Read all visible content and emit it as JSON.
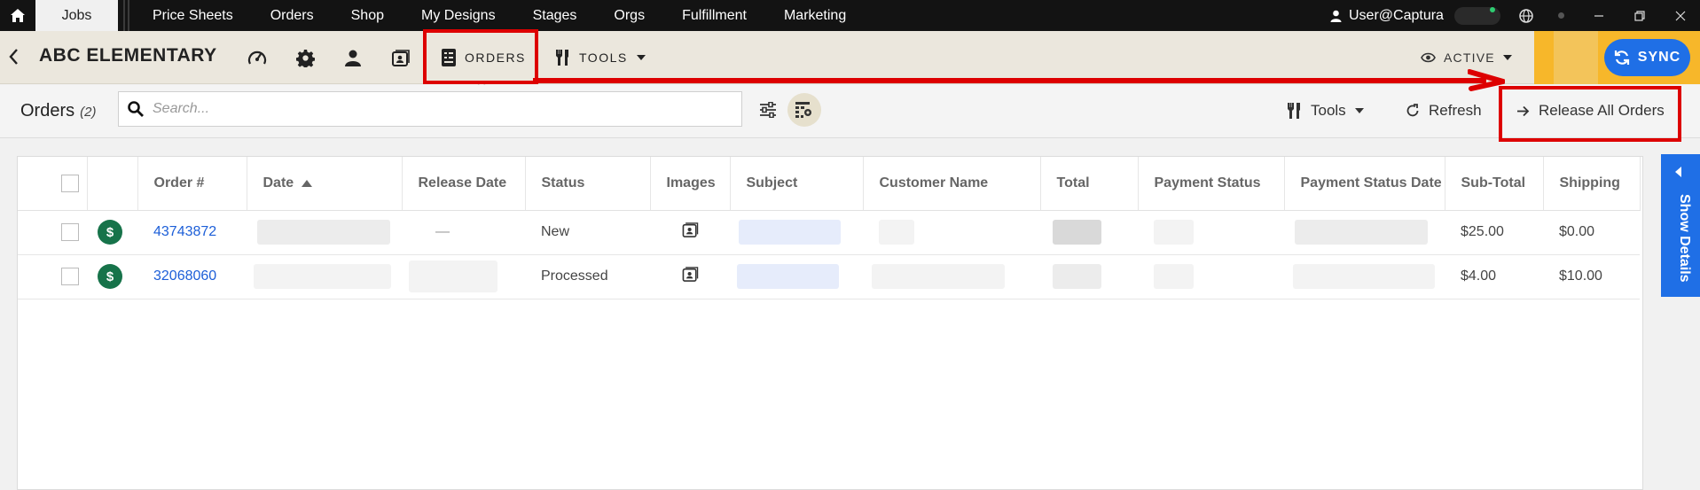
{
  "topnav": {
    "tabs": [
      {
        "label": "Jobs"
      },
      {
        "label": "Price Sheets"
      },
      {
        "label": "Orders"
      },
      {
        "label": "Shop"
      },
      {
        "label": "My Designs"
      },
      {
        "label": "Stages"
      },
      {
        "label": "Orgs"
      },
      {
        "label": "Fulfillment"
      },
      {
        "label": "Marketing"
      }
    ],
    "active_tab": "Jobs",
    "user": "User@Captura",
    "status_dot_color": "#2ecc71"
  },
  "jobbar": {
    "title": "ABC ELEMENTARY",
    "icons": [
      "dashboard-icon",
      "gear-icon",
      "person-icon",
      "contact-card-icon"
    ],
    "orders_tab": "ORDERS",
    "tools_tab": "TOOLS",
    "status": "ACTIVE",
    "sync_label": "SYNC"
  },
  "ordersbar": {
    "title": "Orders",
    "count": "(2)",
    "search_placeholder": "Search...",
    "tools_label": "Tools",
    "refresh_label": "Refresh",
    "release_label": "Release All Orders"
  },
  "table": {
    "columns": [
      "Order #",
      "Date",
      "Release Date",
      "Status",
      "Images",
      "Subject",
      "Customer Name",
      "Total",
      "Payment Status",
      "Payment Status Date",
      "Sub-Total",
      "Shipping"
    ],
    "sort_column": "Date",
    "rows": [
      {
        "order": "43743872",
        "release": "—",
        "status": "New",
        "subtotal": "$25.00",
        "shipping": "$0.00"
      },
      {
        "order": "32068060",
        "release": "",
        "status": "Processed",
        "subtotal": "$4.00",
        "shipping": "$10.00"
      }
    ]
  },
  "side_panel": {
    "label": "Show Details"
  },
  "colors": {
    "accent_blue": "#1f6fe6",
    "highlight_red": "#dd0000",
    "paid_green": "#17734a"
  }
}
